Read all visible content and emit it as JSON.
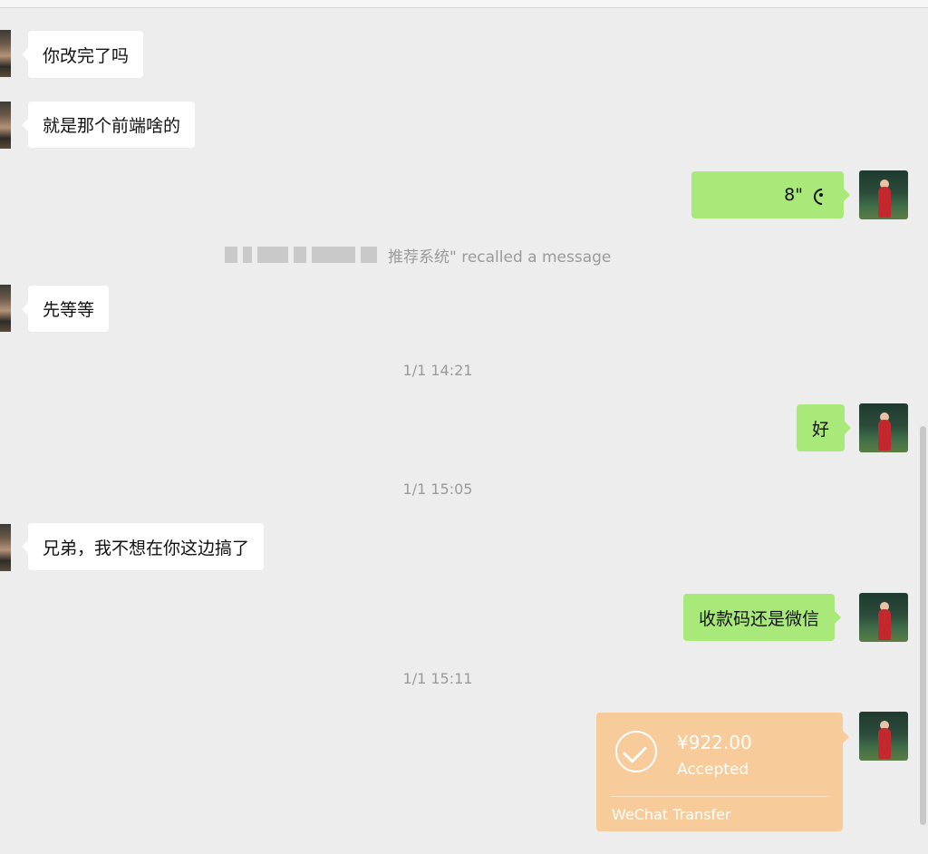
{
  "messages": {
    "m1": "你改完了吗",
    "m2": "就是那个前端啥的",
    "m3": "8\"",
    "m4": "先等等",
    "m5": "好",
    "m6": "兄弟，我不想在你这边搞了",
    "m7": "收款码还是微信"
  },
  "recall": {
    "text": "推荐系统\" recalled a message"
  },
  "timestamps": {
    "t1": "1/1 14:21",
    "t2": "1/1 15:05",
    "t3": "1/1 15:11"
  },
  "transfer": {
    "amount": "¥922.00",
    "status": "Accepted",
    "label": "WeChat Transfer"
  },
  "colors": {
    "background": "#ededed",
    "outgoing_bubble": "#a9e97a",
    "incoming_bubble": "#ffffff",
    "transfer_card": "#f7cb9a",
    "system_text": "#9a9a9a"
  },
  "icons": {
    "voice": "voice-wave-icon",
    "transfer_check": "check-circle-icon"
  }
}
